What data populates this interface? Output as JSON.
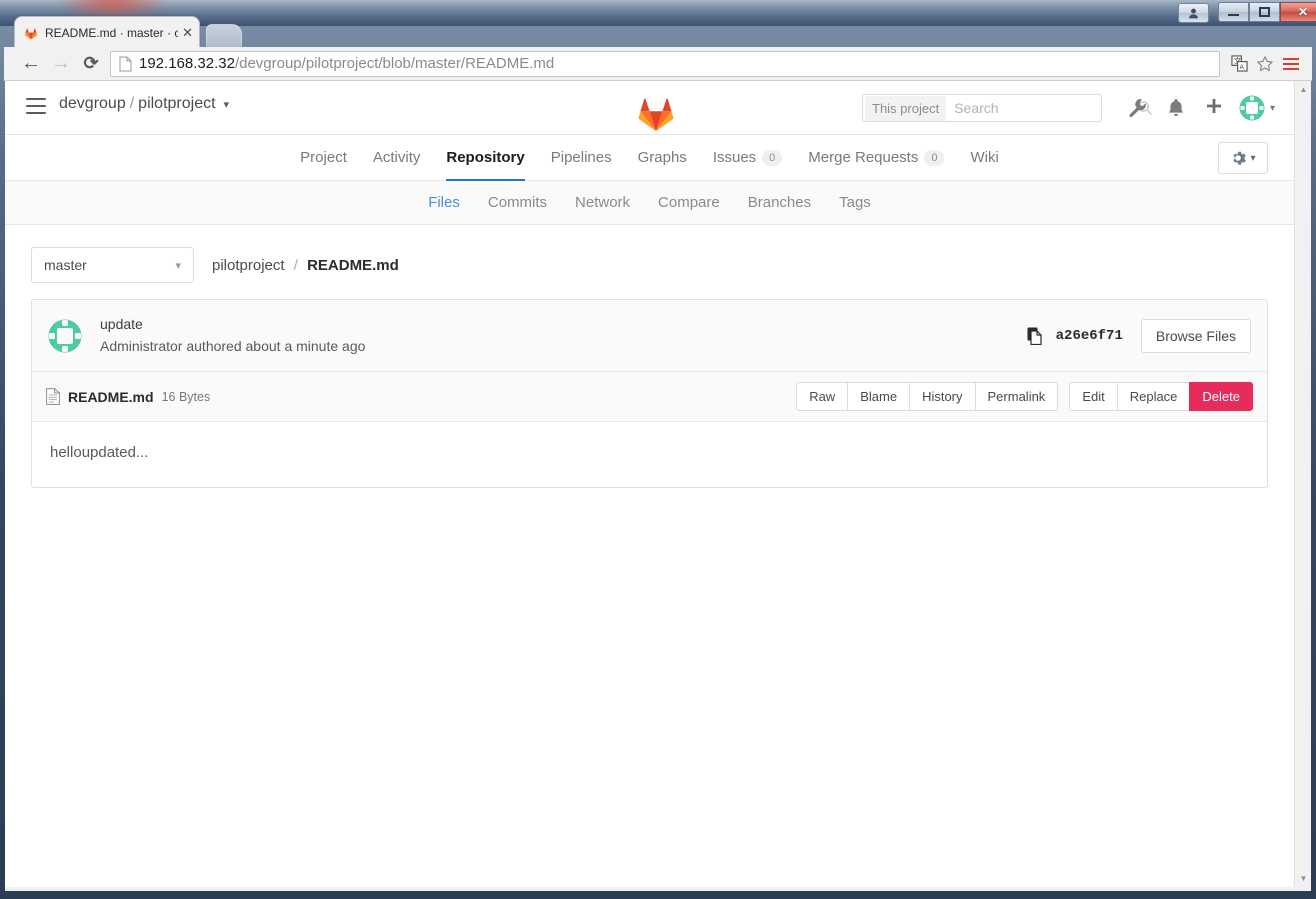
{
  "window": {
    "buttons": {
      "person": "person-icon",
      "minimize": "–",
      "maximize": "❐",
      "close": "✕"
    }
  },
  "browser": {
    "tab": {
      "title": "README.md · master · c",
      "favicon": "gitlab-favicon",
      "close_label": "✕"
    },
    "nav": {
      "back": "←",
      "forward": "→",
      "reload": "⟳"
    },
    "omnibox": {
      "host": "192.168.32.32",
      "path": "/devgroup/pilotproject/blob/master/README.md"
    },
    "right_icons": [
      "translate-icon",
      "bookmark-star-icon",
      "chrome-menu-icon"
    ]
  },
  "gitlab": {
    "header": {
      "hamburger": "hamburger-icon",
      "group": "devgroup",
      "separator": "/",
      "project": "pilotproject",
      "project_caret": "⌄",
      "logo": "gitlab-tanuki-logo",
      "search": {
        "scope": "This project",
        "placeholder": "Search",
        "value": ""
      },
      "icons": [
        "wrench-icon",
        "bell-icon",
        "plus-icon",
        "avatar-icon"
      ],
      "avatar_caret": "▾"
    },
    "nav_tabs": [
      {
        "label": "Project",
        "active": false,
        "badge": null
      },
      {
        "label": "Activity",
        "active": false,
        "badge": null
      },
      {
        "label": "Repository",
        "active": true,
        "badge": null
      },
      {
        "label": "Pipelines",
        "active": false,
        "badge": null
      },
      {
        "label": "Graphs",
        "active": false,
        "badge": null
      },
      {
        "label": "Issues",
        "active": false,
        "badge": "0"
      },
      {
        "label": "Merge Requests",
        "active": false,
        "badge": "0"
      },
      {
        "label": "Wiki",
        "active": false,
        "badge": null
      }
    ],
    "gear_dropdown": {
      "icon": "gear-icon",
      "caret": "▾"
    },
    "sub_tabs": [
      {
        "label": "Files",
        "active": true
      },
      {
        "label": "Commits",
        "active": false
      },
      {
        "label": "Network",
        "active": false
      },
      {
        "label": "Compare",
        "active": false
      },
      {
        "label": "Branches",
        "active": false
      },
      {
        "label": "Tags",
        "active": false
      }
    ],
    "file_bar": {
      "branch": "master",
      "branch_caret": "⌄",
      "crumb_project": "pilotproject",
      "crumb_sep": "/",
      "crumb_file": "README.md"
    },
    "commit": {
      "avatar": "identicon-avatar",
      "title": "update",
      "meta": "Administrator authored about a minute ago",
      "copy_icon": "copy-to-clipboard-icon",
      "sha": "a26e6f71",
      "browse_files": "Browse Files"
    },
    "file_header": {
      "doc_icon": "file-document-icon",
      "name": "README.md",
      "size": "16 Bytes",
      "actions_left": [
        "Raw",
        "Blame",
        "History",
        "Permalink"
      ],
      "actions_right": [
        "Edit",
        "Replace",
        "Delete"
      ],
      "danger_action": "Delete"
    },
    "file_content": "helloupdated...",
    "scrollbar": {
      "up": "▲",
      "down": "▼"
    }
  },
  "colors": {
    "accent_blue": "#1f78d1",
    "link_blue": "#4a90d9",
    "danger_red": "#e52c5a",
    "avatar_green": "#4ecba5",
    "gitlab_orange": "#e24329",
    "chrome_menu_red": "#dd3b30"
  }
}
